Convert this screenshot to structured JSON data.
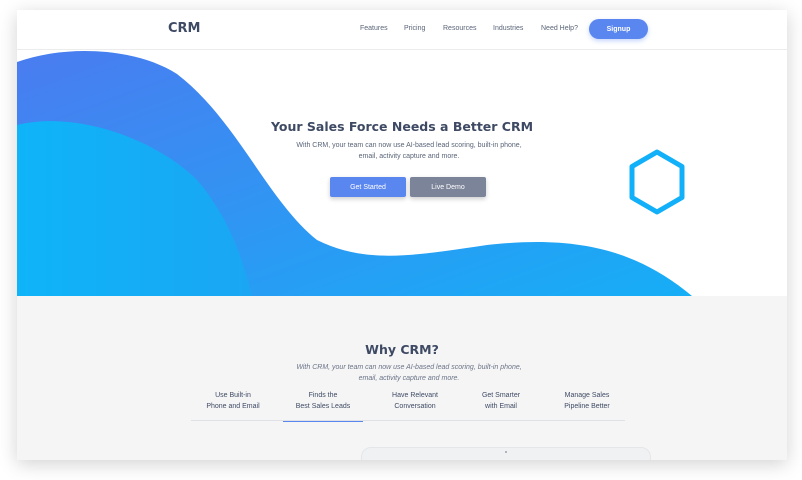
{
  "header": {
    "logo": "CRM",
    "nav": [
      "Features",
      "Pricing",
      "Resources",
      "Industries",
      "Need Help?"
    ],
    "signup_label": "Signup"
  },
  "hero": {
    "title": "Your Sales Force Needs a Better CRM",
    "subtitle": "With CRM, your team can now use AI-based lead scoring, built-in phone, email, activity capture and more.",
    "primary_button": "Get Started",
    "secondary_button": "Live Demo"
  },
  "why": {
    "title": "Why CRM?",
    "subtitle": "With CRM, your team can now use AI-based lead scoring, built-in phone, email, activity capture and more.",
    "tabs": [
      {
        "line1": "Use Built-in",
        "line2": "Phone and Email"
      },
      {
        "line1": "Finds the",
        "line2": "Best Sales Leads"
      },
      {
        "line1": "Have Relevant",
        "line2": "Conversation"
      },
      {
        "line1": "Get Smarter",
        "line2": "with Email"
      },
      {
        "line1": "Manage Sales",
        "line2": "Pipeline Better"
      }
    ],
    "active_tab_index": 1
  },
  "colors": {
    "accent": "#5a86f0",
    "heading": "#3e4a63",
    "wave_blue": "#4a7ef0",
    "wave_cyan": "#13b0f7",
    "hex_outline": "#12b0f8",
    "secondary_button": "#7b8499"
  },
  "icons": [
    "hexagon-outline-icon"
  ]
}
